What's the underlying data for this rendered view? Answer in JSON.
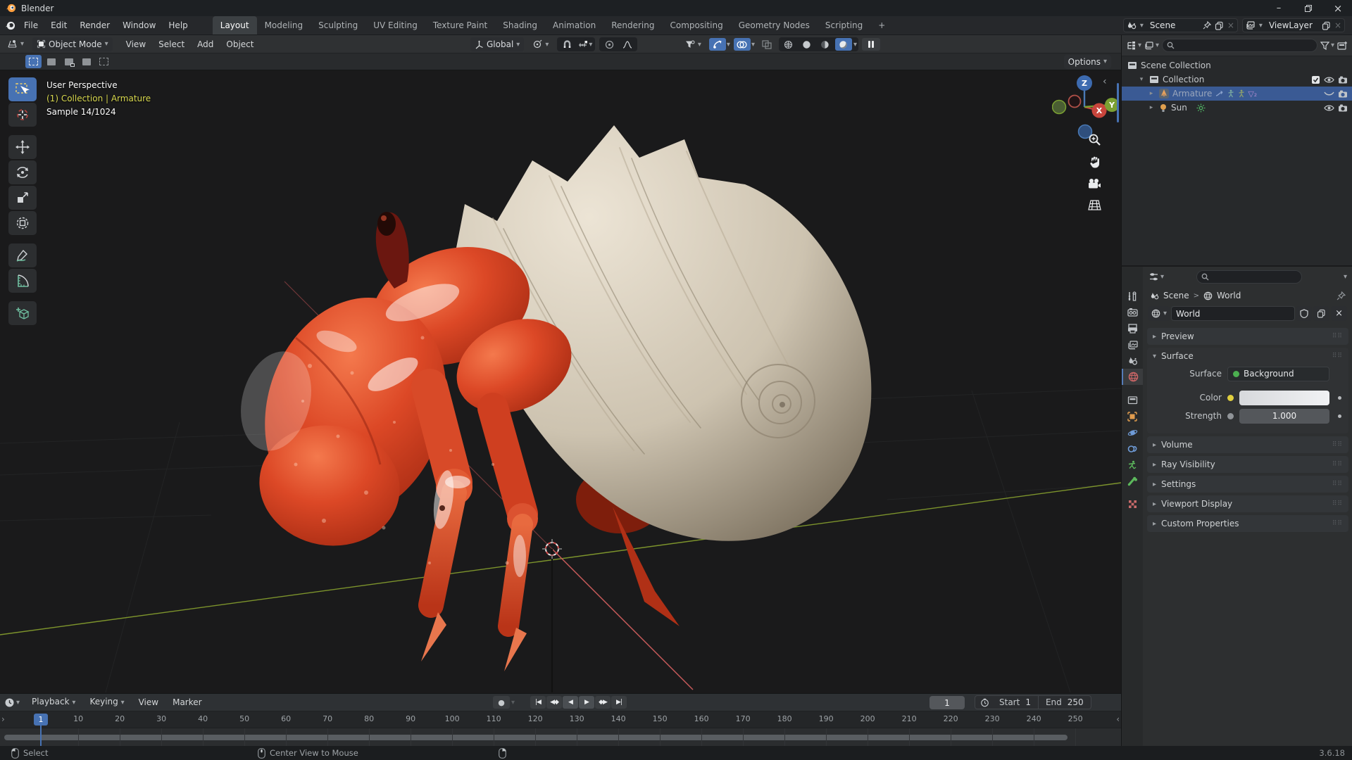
{
  "icons": {
    "chevron_down": "▾",
    "chevron_right": "▸",
    "breadcrumb_sep": ">",
    "checkmark": "✓",
    "close": "×",
    "minimize": "–",
    "plus": "+",
    "record": "●",
    "collapse_left": "‹",
    "collapse_right": "›",
    "panel_grip": "⠿⠿",
    "armature_modifier_badge": "▽₂",
    "playback": [
      "|◀",
      "◀◆",
      "◀",
      "▶",
      "◆▶",
      "▶|"
    ]
  },
  "window": {
    "title": "Blender"
  },
  "topbar": {
    "menus": [
      "File",
      "Edit",
      "Render",
      "Window",
      "Help"
    ],
    "workspaces": [
      "Layout",
      "Modeling",
      "Sculpting",
      "UV Editing",
      "Texture Paint",
      "Shading",
      "Animation",
      "Rendering",
      "Compositing",
      "Geometry Nodes",
      "Scripting"
    ],
    "active_workspace": "Layout",
    "scene": {
      "label": "Scene"
    },
    "view_layer": {
      "label": "ViewLayer"
    }
  },
  "viewport": {
    "header": {
      "mode": "Object Mode",
      "menus": [
        "View",
        "Select",
        "Add",
        "Object"
      ],
      "orientation": "Global"
    },
    "tool_settings": {
      "options_label": "Options"
    },
    "overlay": {
      "line1": "User Perspective",
      "line2": "(1) Collection | Armature",
      "line3": "Sample 14/1024"
    },
    "gizmo": {
      "x": "X",
      "y": "Y",
      "z": "Z"
    }
  },
  "outliner": {
    "rows": [
      {
        "label": "Scene Collection"
      },
      {
        "label": "Collection"
      },
      {
        "label": "Armature"
      },
      {
        "label": "Sun"
      }
    ]
  },
  "properties": {
    "breadcrumb": {
      "left": "Scene",
      "right": "World"
    },
    "datablock": {
      "name": "World"
    },
    "panels": {
      "preview": "Preview",
      "surface": {
        "title": "Surface",
        "surface_label": "Surface",
        "surface_value": "Background",
        "color_label": "Color",
        "strength_label": "Strength",
        "strength_value": "1.000"
      },
      "collapsed": [
        "Volume",
        "Ray Visibility",
        "Settings",
        "Viewport Display",
        "Custom Properties"
      ]
    },
    "tabs": [
      "tool",
      "render",
      "output",
      "view-layer",
      "scene",
      "world",
      "collection",
      "object",
      "physics",
      "constraints",
      "object-data",
      "bone",
      "texture"
    ],
    "active_tab": "world"
  },
  "timeline": {
    "menus": [
      "Playback",
      "Keying",
      "View",
      "Marker"
    ],
    "current_frame": "1",
    "start_label": "Start",
    "start_value": "1",
    "end_label": "End",
    "end_value": "250",
    "ticks": [
      1,
      10,
      20,
      30,
      40,
      50,
      60,
      70,
      80,
      90,
      100,
      110,
      120,
      130,
      140,
      150,
      160,
      170,
      180,
      190,
      200,
      210,
      220,
      230,
      240,
      250
    ]
  },
  "statusbar": {
    "left": "Select",
    "middle": "Center View to Mouse",
    "version": "3.6.18"
  }
}
